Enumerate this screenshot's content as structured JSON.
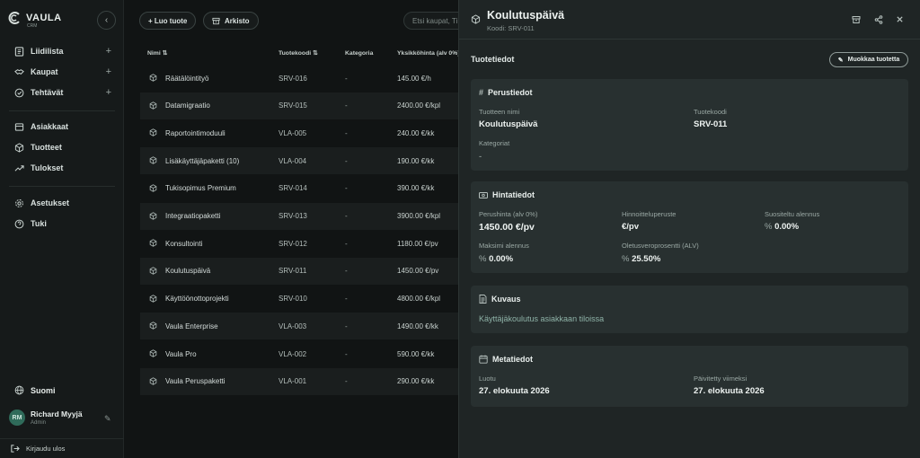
{
  "app": {
    "logo": "VAULA",
    "logo_sub": "CRM"
  },
  "sidebar": {
    "items": [
      {
        "label": "Liidilista",
        "icon": "list-icon",
        "has_plus": true
      },
      {
        "label": "Kaupat",
        "icon": "handshake-icon",
        "has_plus": true
      },
      {
        "label": "Tehtävät",
        "icon": "check-circle-icon",
        "has_plus": true
      },
      {
        "label": "Asiakkaat",
        "icon": "users-icon"
      },
      {
        "label": "Tuotteet",
        "icon": "cube-icon"
      },
      {
        "label": "Tulokset",
        "icon": "trend-icon"
      },
      {
        "label": "Asetukset",
        "icon": "gear-icon"
      },
      {
        "label": "Tuki",
        "icon": "help-icon"
      }
    ],
    "language": "Suomi",
    "user": {
      "initials": "RM",
      "name": "Richard Myyjä",
      "role": "Admin"
    },
    "logout": "Kirjaudu ulos"
  },
  "toolbar": {
    "new_product": "+ Luo tuote",
    "archive": "Arkisto",
    "search_placeholder": "Etsi kaupat, Ti..."
  },
  "table": {
    "headers": {
      "name": "Nimi",
      "code": "Tuotekoodi",
      "category": "Kategoria",
      "price": "Yksikköhinta (alv 0%)"
    },
    "rows": [
      {
        "name": "Räätälöintityö",
        "code": "SRV-016",
        "category": "-",
        "price": "145.00 €/h"
      },
      {
        "name": "Datamigraatio",
        "code": "SRV-015",
        "category": "-",
        "price": "2400.00 €/kpl"
      },
      {
        "name": "Raportointimoduuli",
        "code": "VLA-005",
        "category": "-",
        "price": "240.00 €/kk"
      },
      {
        "name": "Lisäkäyttäjäpaketti (10)",
        "code": "VLA-004",
        "category": "-",
        "price": "190.00 €/kk"
      },
      {
        "name": "Tukisopimus Premium",
        "code": "SRV-014",
        "category": "-",
        "price": "390.00 €/kk"
      },
      {
        "name": "Integraatiopaketti",
        "code": "SRV-013",
        "category": "-",
        "price": "3900.00 €/kpl"
      },
      {
        "name": "Konsultointi",
        "code": "SRV-012",
        "category": "-",
        "price": "1180.00 €/pv"
      },
      {
        "name": "Koulutuspäivä",
        "code": "SRV-011",
        "category": "-",
        "price": "1450.00 €/pv"
      },
      {
        "name": "Käyttöönottoprojekti",
        "code": "SRV-010",
        "category": "-",
        "price": "4800.00 €/kpl"
      },
      {
        "name": "Vaula Enterprise",
        "code": "VLA-003",
        "category": "-",
        "price": "1490.00 €/kk"
      },
      {
        "name": "Vaula Pro",
        "code": "VLA-002",
        "category": "-",
        "price": "590.00 €/kk"
      },
      {
        "name": "Vaula Peruspaketti",
        "code": "VLA-001",
        "category": "-",
        "price": "290.00 €/kk"
      }
    ]
  },
  "panel": {
    "title": "Koulutuspäivä",
    "subtitle": "Koodi: SRV-011",
    "section": "Tuotetiedot",
    "edit_button": "Muokkaa tuotetta",
    "basic": {
      "title": "Perustiedot",
      "name_label": "Tuotteen nimi",
      "name_value": "Koulutuspäivä",
      "code_label": "Tuotekoodi",
      "code_value": "SRV-011",
      "category_label": "Kategoriat",
      "category_value": "-"
    },
    "pricing": {
      "title": "Hintatiedot",
      "base_label": "Perushinta (alv 0%)",
      "base_value": "1450.00 €/pv",
      "basis_label": "Hinnoitteluperuste",
      "basis_value": "€/pv",
      "rec_discount_label": "Suositeltu alennus",
      "rec_discount_value": "0.00%",
      "max_discount_label": "Maksimi alennus",
      "max_discount_value": "0.00%",
      "vat_label": "Oletusveroprosentti (ALV)",
      "vat_value": "25.50%"
    },
    "description": {
      "title": "Kuvaus",
      "text": "Käyttäjäkoulutus asiakkaan tiloissa"
    },
    "meta": {
      "title": "Metatiedot",
      "created_label": "Luotu",
      "created_value": "27. elokuuta 2026",
      "updated_label": "Päivitetty viimeksi",
      "updated_value": "27. elokuuta 2026"
    }
  }
}
